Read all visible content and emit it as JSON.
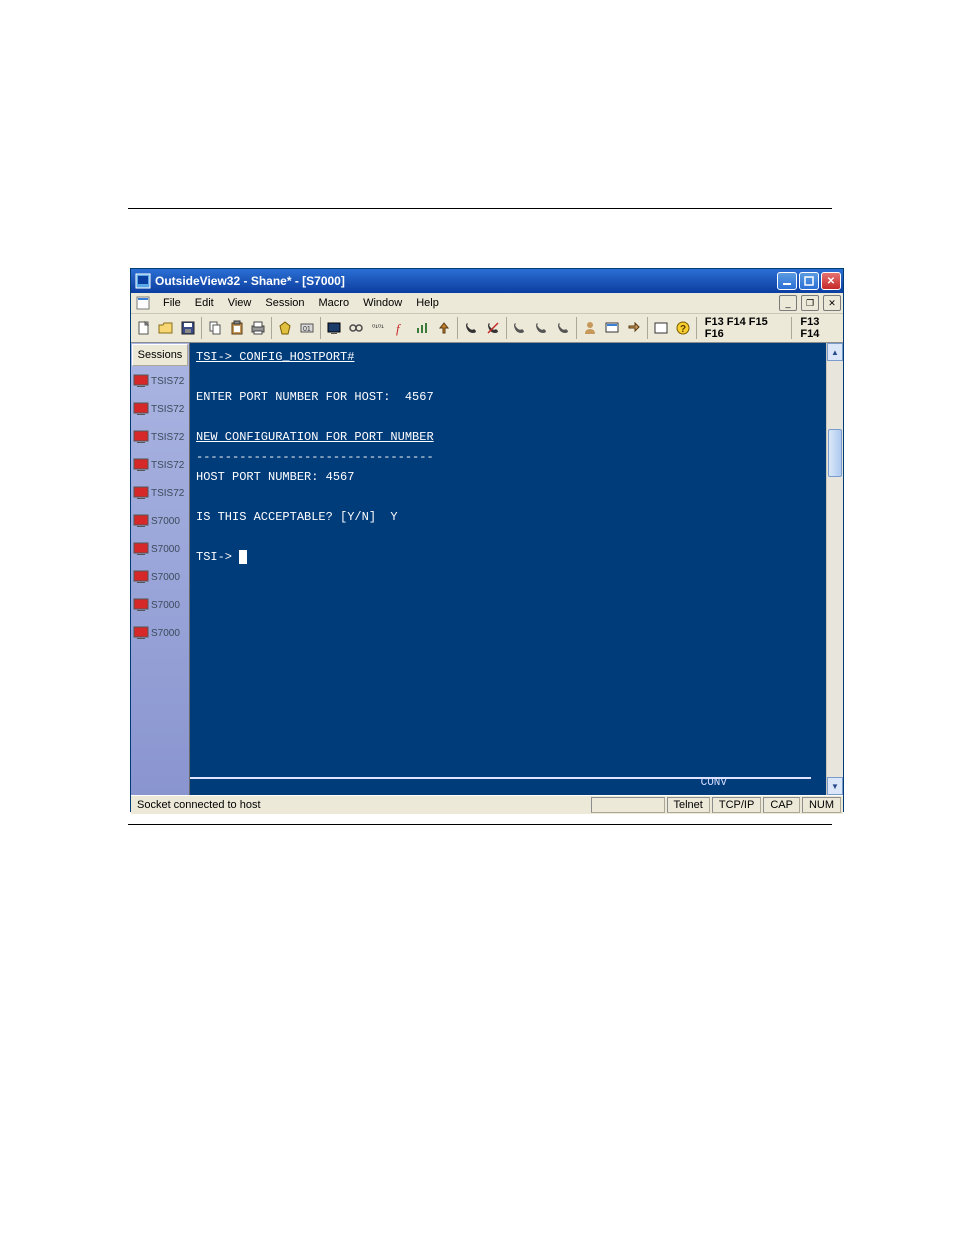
{
  "title": "OutsideView32 - Shane* - [S7000]",
  "menus": [
    "File",
    "Edit",
    "View",
    "Session",
    "Macro",
    "Window",
    "Help"
  ],
  "fkeys_a": "F13 F14 F15 F16",
  "fkeys_b": "F13 F14",
  "sessions_header": "Sessions",
  "sessions": [
    {
      "label": "TSIS72"
    },
    {
      "label": "TSIS72"
    },
    {
      "label": "TSIS72"
    },
    {
      "label": "TSIS72"
    },
    {
      "label": "TSIS72"
    },
    {
      "label": "S7000"
    },
    {
      "label": "S7000"
    },
    {
      "label": "S7000"
    },
    {
      "label": "S7000"
    },
    {
      "label": "S7000"
    }
  ],
  "terminal": {
    "line1": "TSI-> CONFIG_HOSTPORT#",
    "line2": "",
    "line3": "ENTER PORT NUMBER FOR HOST:  4567",
    "line4": "",
    "line5": "NEW CONFIGURATION FOR PORT NUMBER",
    "line6": "---------------------------------",
    "line7": "HOST PORT NUMBER: 4567",
    "line8": "",
    "line9": "IS THIS ACCEPTABLE? [Y/N]  Y",
    "line10": "",
    "line11": "TSI-> "
  },
  "conv_label": "CONV",
  "status": {
    "left": "Socket connected to host",
    "c1": "Telnet",
    "c2": "TCP/IP",
    "c3": "CAP",
    "c4": "NUM"
  }
}
